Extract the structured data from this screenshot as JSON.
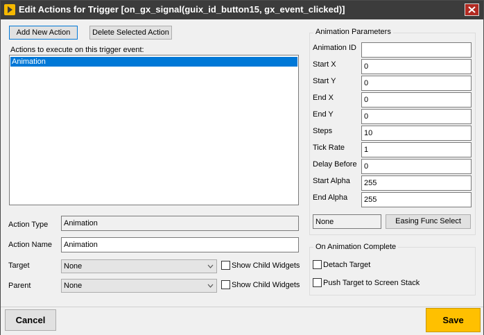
{
  "window": {
    "title": "Edit Actions for Trigger [on_gx_signal(guix_id_button15, gx_event_clicked)]"
  },
  "toolbar": {
    "add_label": "Add New Action",
    "delete_label": "Delete Selected Action"
  },
  "actions": {
    "list_label": "Actions to execute on this trigger event:",
    "items": [
      "Animation"
    ]
  },
  "details": {
    "action_type_label": "Action Type",
    "action_type_value": "Animation",
    "action_name_label": "Action Name",
    "action_name_value": "Animation",
    "target_label": "Target",
    "target_value": "None",
    "parent_label": "Parent",
    "parent_value": "None",
    "show_child_label": "Show Child Widgets"
  },
  "animation_params": {
    "group_title": "Animation Parameters",
    "fields": [
      {
        "label": "Animation ID",
        "value": ""
      },
      {
        "label": "Start X",
        "value": "0"
      },
      {
        "label": "Start Y",
        "value": "0"
      },
      {
        "label": "End X",
        "value": "0"
      },
      {
        "label": "End Y",
        "value": "0"
      },
      {
        "label": "Steps",
        "value": "10"
      },
      {
        "label": "Tick Rate",
        "value": "1"
      },
      {
        "label": "Delay Before",
        "value": "0"
      },
      {
        "label": "Start Alpha",
        "value": "255"
      },
      {
        "label": "End Alpha",
        "value": "255"
      }
    ],
    "easing_value": "None",
    "easing_button": "Easing Func Select"
  },
  "on_complete": {
    "group_title": "On Animation Complete",
    "detach_label": "Detach Target",
    "push_label": "Push Target to Screen Stack"
  },
  "footer": {
    "cancel_label": "Cancel",
    "save_label": "Save"
  },
  "colors": {
    "titlebar": "#3c3c3c",
    "selection": "#0078d7",
    "save_button": "#ffc000",
    "close_button": "#b22a22"
  }
}
